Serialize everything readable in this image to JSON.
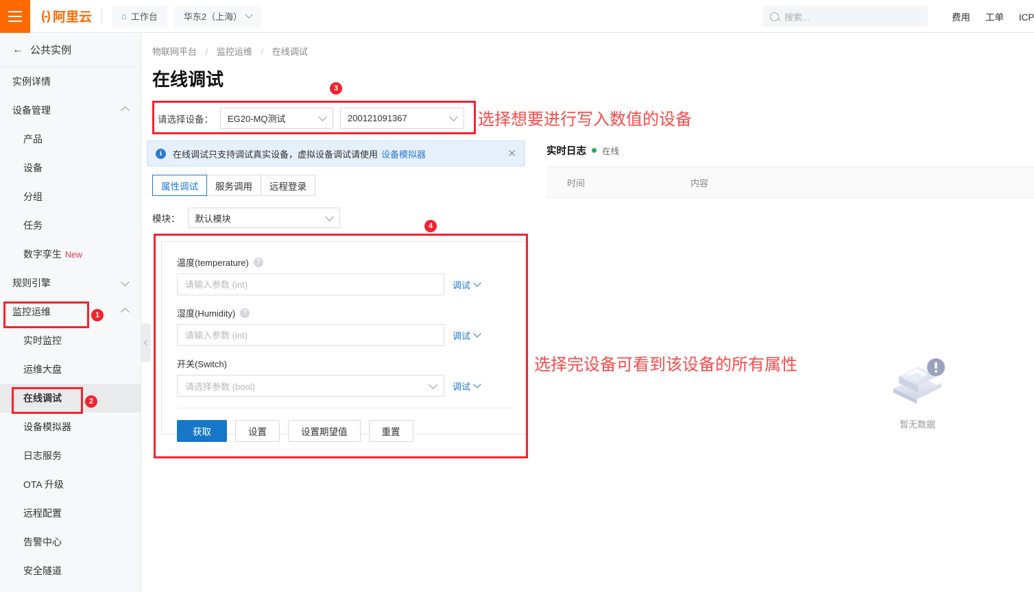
{
  "header": {
    "menu_icon": "hamburger-icon",
    "logo_text": "阿里云",
    "logo_mark": "(-)",
    "workbench": "工作台",
    "home_icon": "home-icon",
    "region": "华东2（上海）",
    "search_placeholder": "搜索...",
    "search_icon": "search-icon",
    "links": [
      "费用",
      "工单",
      "ICP 备案"
    ]
  },
  "sidebar": {
    "back_label": "公共实例",
    "back_icon": "arrow-left-icon",
    "items": [
      {
        "label": "实例详情",
        "level": 0,
        "expand": null,
        "active": false
      },
      {
        "label": "设备管理",
        "level": 0,
        "expand": "up",
        "active": false
      },
      {
        "label": "产品",
        "level": 1,
        "expand": null,
        "active": false
      },
      {
        "label": "设备",
        "level": 1,
        "expand": null,
        "active": false
      },
      {
        "label": "分组",
        "level": 1,
        "expand": null,
        "active": false
      },
      {
        "label": "任务",
        "level": 1,
        "expand": null,
        "active": false
      },
      {
        "label": "数字孪生",
        "tag": "New",
        "level": 1,
        "expand": null,
        "active": false
      },
      {
        "label": "规则引擎",
        "level": 0,
        "expand": "down",
        "active": false
      },
      {
        "label": "监控运维",
        "level": 0,
        "expand": "up",
        "active": false
      },
      {
        "label": "实时监控",
        "level": 1,
        "expand": null,
        "active": false
      },
      {
        "label": "运维大盘",
        "level": 1,
        "expand": null,
        "active": false
      },
      {
        "label": "在线调试",
        "level": 1,
        "expand": null,
        "active": true
      },
      {
        "label": "设备模拟器",
        "level": 1,
        "expand": null,
        "active": false
      },
      {
        "label": "日志服务",
        "level": 1,
        "expand": null,
        "active": false
      },
      {
        "label": "OTA 升级",
        "level": 1,
        "expand": null,
        "active": false
      },
      {
        "label": "远程配置",
        "level": 1,
        "expand": null,
        "active": false
      },
      {
        "label": "告警中心",
        "level": 1,
        "expand": null,
        "active": false
      },
      {
        "label": "安全隧道",
        "level": 1,
        "expand": null,
        "active": false
      }
    ],
    "collapse_icon": "chevron-left-icon"
  },
  "breadcrumb": {
    "items": [
      "物联网平台",
      "监控运维",
      "在线调试"
    ],
    "separator": "/"
  },
  "page": {
    "title": "在线调试"
  },
  "device_selector": {
    "label": "请选择设备：",
    "product_value": "EG20-MQ测试",
    "device_value": "200121091367"
  },
  "alert": {
    "icon": "info-icon",
    "text": "在线调试只支持调试真实设备，虚拟设备调试请使用",
    "link": "设备模拟器",
    "close_icon": "close-icon"
  },
  "tabs": [
    {
      "label": "属性调试",
      "active": true
    },
    {
      "label": "服务调用",
      "active": false
    },
    {
      "label": "远程登录",
      "active": false
    }
  ],
  "module": {
    "label": "模块：",
    "value": "默认模块"
  },
  "properties": [
    {
      "label": "温度(temperature)",
      "has_help": true,
      "type": "input",
      "placeholder": "请输入参数 (int)",
      "value": "",
      "debug_label": "调试"
    },
    {
      "label": "湿度(Humidity)",
      "has_help": true,
      "type": "input",
      "placeholder": "请输入参数 (int)",
      "value": "",
      "debug_label": "调试"
    },
    {
      "label": "开关(Switch)",
      "has_help": false,
      "type": "select",
      "placeholder": "请选择参数 (bool)",
      "value": "",
      "debug_label": "调试"
    }
  ],
  "action_buttons": [
    {
      "label": "获取",
      "primary": true
    },
    {
      "label": "设置",
      "primary": false
    },
    {
      "label": "设置期望值",
      "primary": false
    },
    {
      "label": "重置",
      "primary": false
    }
  ],
  "log_panel": {
    "title": "实时日志",
    "status": "在线",
    "status_color": "#27a862",
    "columns": [
      "时间",
      "内容"
    ],
    "empty_text": "暂无数据",
    "empty_icon": "empty-box-icon"
  },
  "annotations": [
    {
      "id": "1",
      "text": null,
      "badge": "1"
    },
    {
      "id": "2",
      "text": null,
      "badge": "2"
    },
    {
      "id": "3",
      "text": "选择想要进行写入数值的设备",
      "badge": "3"
    },
    {
      "id": "4",
      "text": "选择完设备可看到该设备的所有属性",
      "badge": "4"
    }
  ],
  "colors": {
    "brand_orange": "#ff6a00",
    "accent_blue": "#1677c9",
    "annotation_red": "#f5222d"
  }
}
